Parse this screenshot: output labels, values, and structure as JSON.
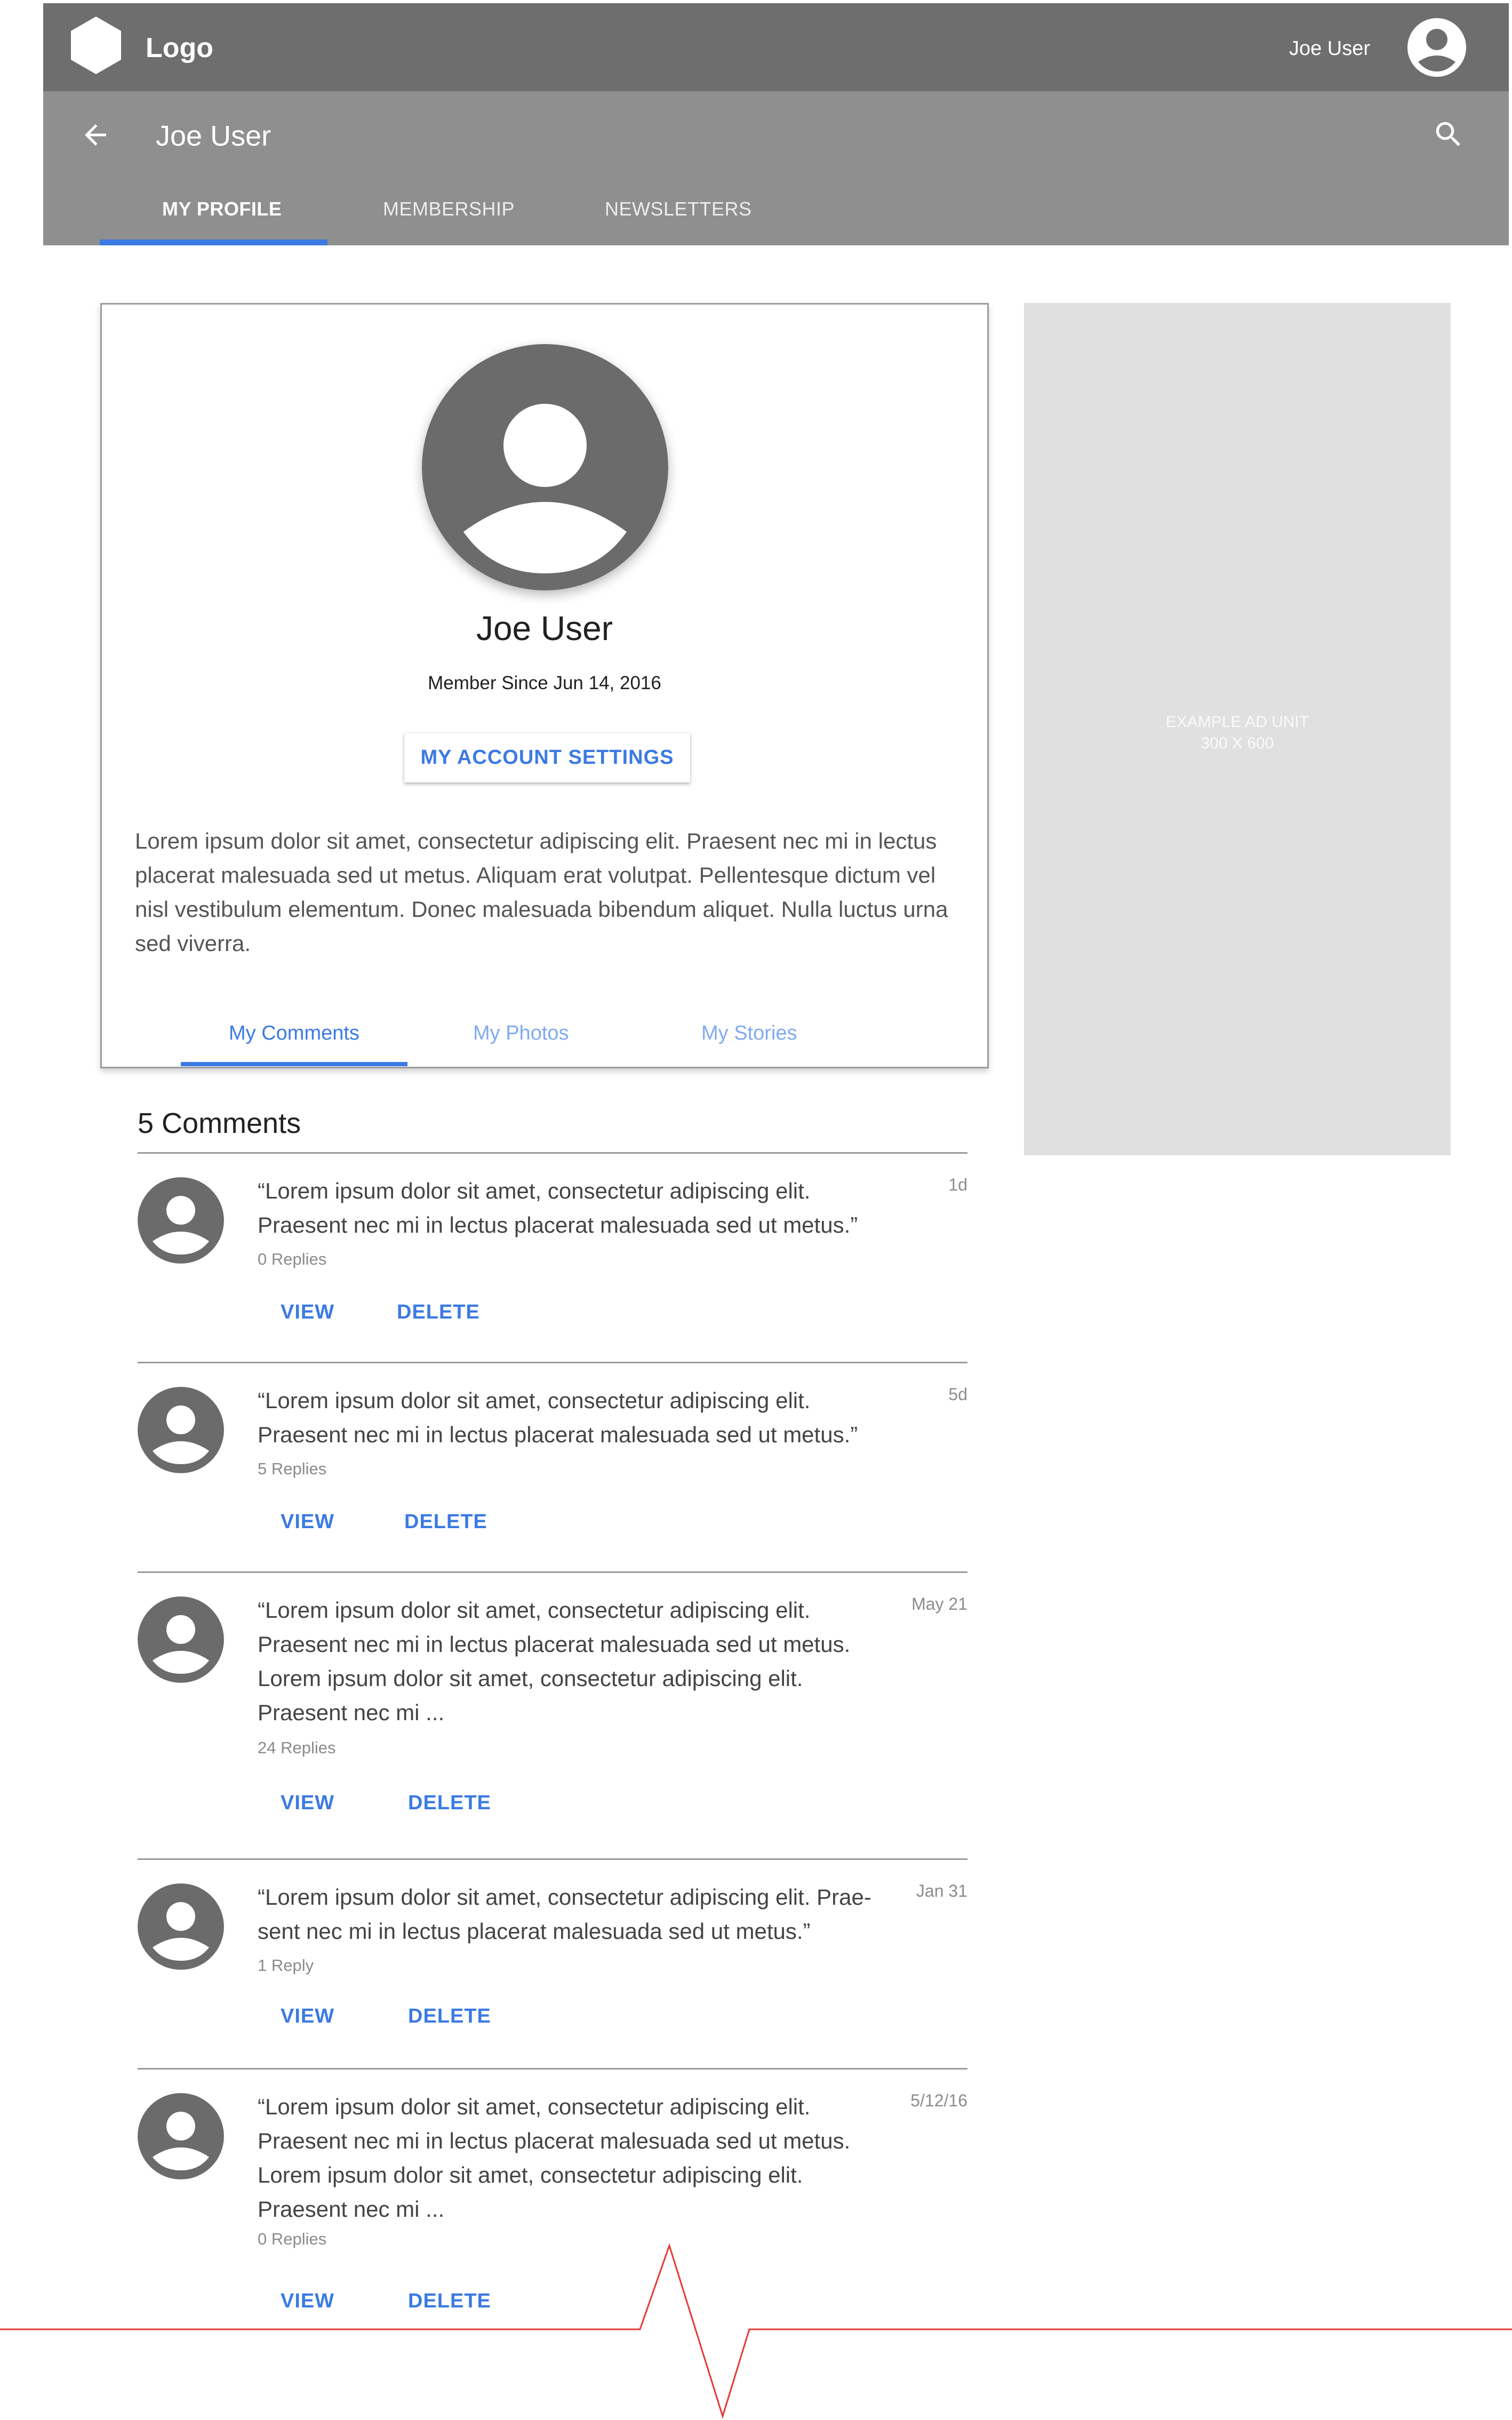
{
  "app_bar": {
    "logo_text": "Logo",
    "user_name": "Joe User"
  },
  "sub_bar": {
    "title": "Joe User",
    "tabs": [
      {
        "label": "MY PROFILE",
        "active": true
      },
      {
        "label": "MEMBERSHIP",
        "active": false
      },
      {
        "label": "NEWSLETTERS",
        "active": false
      }
    ]
  },
  "profile": {
    "name": "Joe User",
    "member_since": "Member Since Jun 14, 2016",
    "account_button": "MY ACCOUNT SETTINGS",
    "bio": "Lorem ipsum dolor sit amet, consectetur adipiscing elit. Praesent nec mi in lectus placerat malesuada sed ut metus. Aliquam erat volutpat. Pellentesque dictum vel nisl vestibulum elementum. Donec malesuada bibendum aliquet. Nulla luctus urna sed viverra.",
    "tabs": [
      {
        "label": "My Comments",
        "active": true
      },
      {
        "label": "My Photos",
        "active": false
      },
      {
        "label": "My Stories",
        "active": false
      }
    ]
  },
  "ad": {
    "line1": "EXAMPLE AD UNIT",
    "line2": "300 X 600"
  },
  "comments": {
    "title": "5 Comments",
    "view_label": "VIEW",
    "delete_label": "DELETE",
    "items": [
      {
        "text": "“Lorem ipsum dolor sit amet, consectetur adipiscing elit. Praesent nec mi in lectus placerat malesuada sed ut metus.”",
        "time": "1d",
        "replies": "0 Replies"
      },
      {
        "text": "“Lorem ipsum dolor sit amet, consectetur adipiscing elit. Praesent nec mi in lectus placerat malesuada sed ut metus.”",
        "time": "5d",
        "replies": "5 Replies"
      },
      {
        "text": "“Lorem ipsum dolor sit amet, consectetur adipiscing elit. Praesent nec mi in lectus placerat malesuada sed ut metus. Lorem ipsum dolor sit amet, consectetur adipiscing elit. Praesent nec mi ...",
        "time": "May 21",
        "replies": "24 Replies"
      },
      {
        "text": "“Lorem ipsum dolor sit amet, consectetur adipiscing elit. Prae-sent nec mi in lectus placerat malesuada sed ut metus.”",
        "time": "Jan 31",
        "replies": "1 Reply"
      },
      {
        "text": "“Lorem ipsum dolor sit amet, consectetur adipiscing elit. Praesent nec mi in lectus placerat malesuada sed ut metus. Lorem ipsum dolor sit amet, consectetur adipiscing elit. Praesent nec mi ...",
        "time": "5/12/16",
        "replies": "0 Replies"
      }
    ]
  },
  "colors": {
    "app_bar": "#6e6e6e",
    "sub_bar": "#8f8f8f",
    "accent": "#3b7ae3",
    "avatar_gray": "#6b6b6b",
    "ad_background": "#e0e0e0",
    "cut_line": "#e53935"
  },
  "icons": {
    "logo": "hexagon-icon",
    "user": "account-circle-icon",
    "back": "arrow-back-icon",
    "search": "search-icon",
    "avatar": "person-icon"
  }
}
